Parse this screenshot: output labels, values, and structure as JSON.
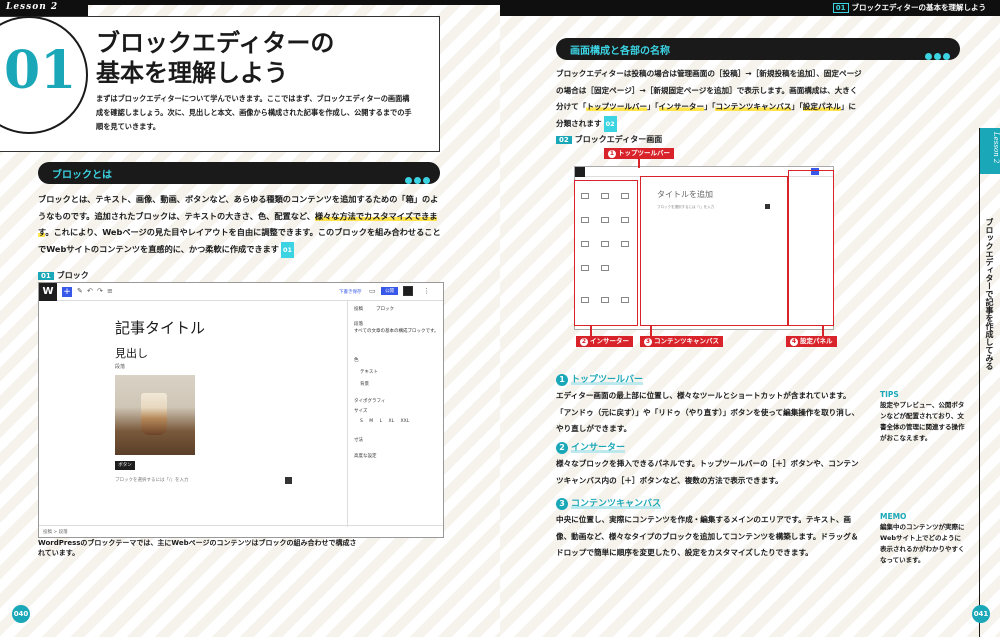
{
  "left_page": {
    "lesson_tag": "Lesson 2",
    "chapter_number": "01",
    "title_line1": "ブロックエディターの",
    "title_line2": "基本を理解しよう",
    "lead": "まずはブロックエディターについて学んでいきます。ここではまず、ブロックエディターの画面構成を確認しましょう。次に、見出しと本文、画像から構成された記事を作成し、公開するまでの手順を見ていきます。",
    "section_title": "ブロックとは",
    "body_parts": [
      "ブロックとは、テキスト、画像、動画、ボタンなど、あらゆる種類のコンテンツを追加するための「箱」のようなものです。追加されたブロックは、テキストの大きさ、色、配置など、",
      "様々な方法でカスタマイズできます",
      "。これにより、Webページの見た目やレイアウトを自由に調整できます。このブロックを組み合わせることでWebサイトのコンテンツを直感的に、かつ柔軟に作成できます",
      "01"
    ],
    "figure_badge": "01",
    "figure_label": "ブロック",
    "editor": {
      "post_title": "記事タイトル",
      "heading": "見出し",
      "paragraph": "段落",
      "button": "ボタン",
      "placeholder": "ブロックを選択するには「/」を入力",
      "sidebar_tab1": "投稿",
      "sidebar_tab2": "ブロック",
      "sidebar_items": [
        "段落",
        "すべての文章の基本の構成ブロックです。",
        "色",
        "テキスト",
        "背景",
        "タイポグラフィ",
        "サイズ",
        "S  M  L  XL  XXL",
        "寸法",
        "高度な設定"
      ],
      "save_draft": "下書き保存",
      "publish": "公開",
      "footer": "投稿 > 段落"
    },
    "caption": "WordPressのブロックテーマでは、主にWebページのコンテンツはブロックの組み合わせで構成されています。",
    "page_number": "040"
  },
  "right_page": {
    "header_num": "01",
    "header_title": "ブロックエディターの基本を理解しよう",
    "section_title": "画面構成と各部の名称",
    "intro_parts": [
      "ブロックエディターは投稿の場合は管理画面の［投稿］→［新規投稿を追加］、固定ページの場合は［固定ページ］→［新規固定ページを追加］で表示します。画面構成は、大きく分けて「",
      "トップツールバー",
      "」「",
      "インサーター",
      "」「",
      "コンテンツキャンバス",
      "」「",
      "設定パネル",
      "」に分類されます",
      "02"
    ],
    "figure_badge": "02",
    "figure_label": "ブロックエディター画面",
    "shot_title_placeholder": "タイトルを追加",
    "shot_placeholder": "ブロックを選択するには「/」を入力",
    "tags": [
      {
        "num": "1",
        "label": "トップツールバー"
      },
      {
        "num": "2",
        "label": "インサーター"
      },
      {
        "num": "3",
        "label": "コンテンツキャンバス"
      },
      {
        "num": "4",
        "label": "設定パネル"
      }
    ],
    "items": [
      {
        "num": "1",
        "title": "トップツールバー",
        "text": "エディター画面の最上部に位置し、様々なツールとショートカットが含まれています。「アンドゥ（元に戻す）」や「リドゥ（やり直す）」ボタンを使って編集操作を取り消し、やり直しができます。"
      },
      {
        "num": "2",
        "title": "インサーター",
        "text": "様々なブロックを挿入できるパネルです。トップツールバーの［＋］ボタンや、コンテンツキャンバス内の［＋］ボタンなど、複数の方法で表示できます。"
      },
      {
        "num": "3",
        "title": "コンテンツキャンバス",
        "text": "中央に位置し、実際にコンテンツを作成・編集するメインのエリアです。テキスト、画像、動画など、様々なタイプのブロックを追加してコンテンツを構築します。ドラッグ＆ドロップで簡単に順序を変更したり、設定をカスタマイズしたりできます。"
      }
    ],
    "tips_head": "TIPS",
    "tips_text": "設定やプレビュー、公開ボタンなどが配置されており、文書全体の管理に関連する操作がおこなえます。",
    "memo_head": "MEMO",
    "memo_text": "編集中のコンテンツが実際にWebサイト上でどのように表示されるかがわかりやすくなっています。",
    "side_tab": "Lesson 2",
    "side_text": "ブロックエディターで記事を作成してみる",
    "page_number": "041"
  },
  "colors": {
    "accent": "#1aa8b8",
    "accent_light": "#3cd3e2",
    "highlight": "#ffe44d",
    "red": "#d8232a",
    "dark": "#1a1a1a"
  }
}
